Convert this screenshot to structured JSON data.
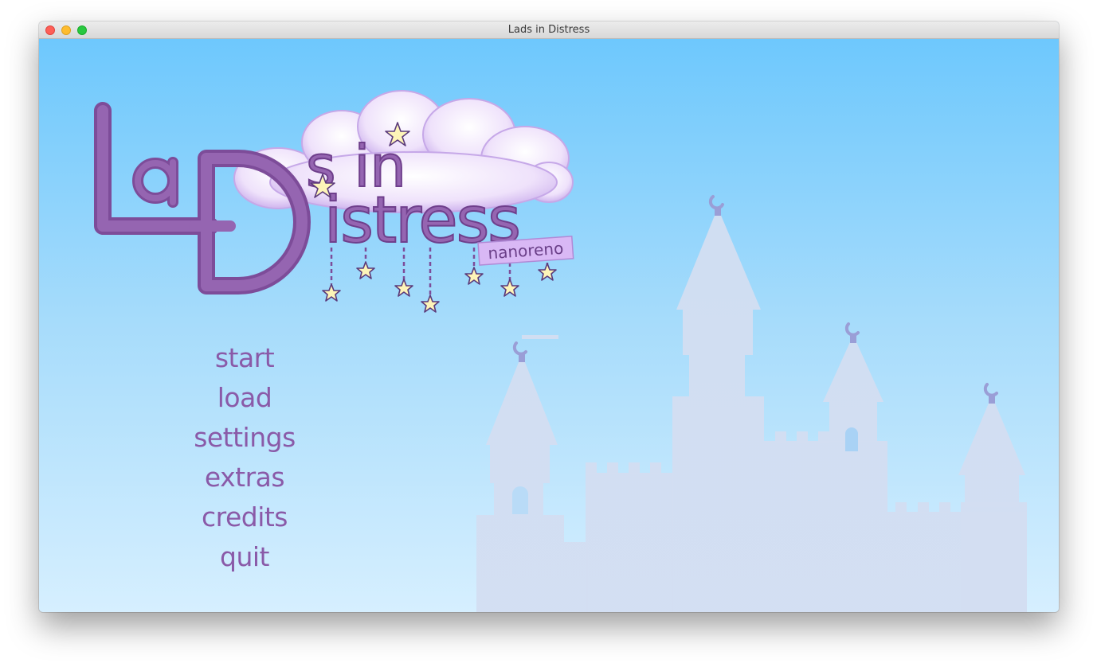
{
  "window": {
    "title": "Lads in Distress"
  },
  "logo": {
    "line1": "La",
    "line2": "Distress",
    "line3": "s in",
    "tag": "nanoreno"
  },
  "menu": {
    "items": [
      {
        "label": "start",
        "name": "start-button"
      },
      {
        "label": "load",
        "name": "load-button"
      },
      {
        "label": "settings",
        "name": "settings-button"
      },
      {
        "label": "extras",
        "name": "extras-button"
      },
      {
        "label": "credits",
        "name": "credits-button"
      },
      {
        "label": "quit",
        "name": "quit-button"
      }
    ]
  },
  "colors": {
    "sky_top": "#6ec8fd",
    "sky_bottom": "#d6efff",
    "menu_text": "#8a5aa8",
    "logo_purple": "#8e5aa8",
    "castle_top": "#9a9ed6",
    "castle_bottom": "#d3dff2"
  }
}
